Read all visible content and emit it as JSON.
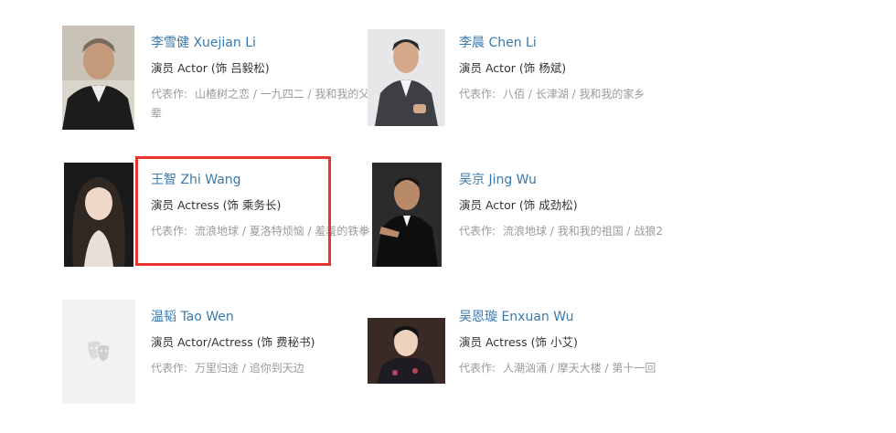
{
  "cast": [
    {
      "name": "李雪健 Xuejian Li",
      "role": "演员 Actor (饰 吕毅松)",
      "works_label": "代表作:",
      "works": "山楂树之恋 / 一九四二 / 我和我的父辈",
      "photo": "portrait-elderly-man-black-jacket"
    },
    {
      "name": "李晨 Chen Li",
      "role": "演员 Actor (饰 杨斌)",
      "works_label": "代表作:",
      "works": "八佰 / 长津湖 / 我和我的家乡",
      "photo": "portrait-man-vest-gray-background"
    },
    {
      "name": "王智 Zhi Wang",
      "role": "演员 Actress (饰 乘务长)",
      "works_label": "代表作:",
      "works": "流浪地球 / 夏洛特烦恼 / 羞羞的铁拳",
      "photo": "portrait-woman-long-hair-dark-background"
    },
    {
      "name": "吴京 Jing Wu",
      "role": "演员 Actor (饰 成劲松)",
      "works_label": "代表作:",
      "works": "流浪地球 / 我和我的祖国 / 战狼2",
      "photo": "portrait-man-tuxedo-pointing"
    },
    {
      "name": "温韬 Tao Wen",
      "role": "演员 Actor/Actress (饰 费秘书)",
      "works_label": "代表作:",
      "works": "万里归途 / 追你到天边",
      "photo": "placeholder-theater-masks-icon"
    },
    {
      "name": "吴恩璇 Enxuan Wu",
      "role": "演员 Actress (饰 小艾)",
      "works_label": "代表作:",
      "works": "人潮汹涌 / 摩天大楼 / 第十一回",
      "photo": "portrait-woman-qipao"
    }
  ],
  "colors": {
    "link": "#3a79ad",
    "highlight": "#e8342f"
  }
}
